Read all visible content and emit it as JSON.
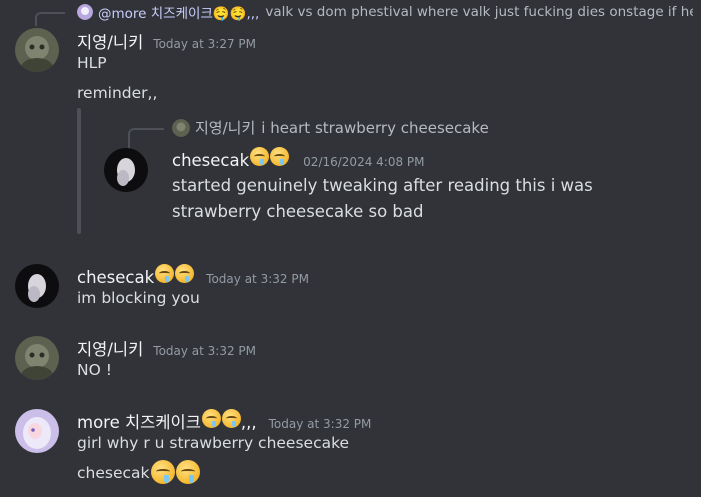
{
  "reply_preview": {
    "author": "@more 치즈케이크🤤🤤,,,",
    "text": "valk vs dom phestival where valk just fucking dies onstage if he"
  },
  "messages": [
    {
      "username": "지영/니키",
      "timestamp": "Today at 3:27 PM",
      "lines": [
        "HLP",
        "reminder,,"
      ]
    },
    {
      "username": "chesecak",
      "timestamp": "Today at 3:32 PM",
      "lines": [
        "im blocking you"
      ]
    },
    {
      "username": "지영/니키",
      "timestamp": "Today at 3:32 PM",
      "lines": [
        "NO !"
      ]
    },
    {
      "username": "more 치즈케이크",
      "username_suffix": ",,,",
      "timestamp": "Today at 3:32 PM",
      "lines": [
        "girl why r u strawberry cheesecake",
        "chesecak"
      ]
    }
  ],
  "forwarded": {
    "reply_author": "지영/니키",
    "reply_text": "i heart strawberry cheesecake",
    "username": "chesecak",
    "timestamp": "02/16/2024 4:08 PM",
    "line1": "started genuinely tweaking after reading this i was",
    "line2": "strawberry cheesecake so bad"
  },
  "emoji_name": "drooling-face-emoji",
  "colors": {
    "background": "#313338",
    "text": "#dbdee1",
    "username": "#f2f3f5",
    "timestamp": "#949ba4"
  }
}
